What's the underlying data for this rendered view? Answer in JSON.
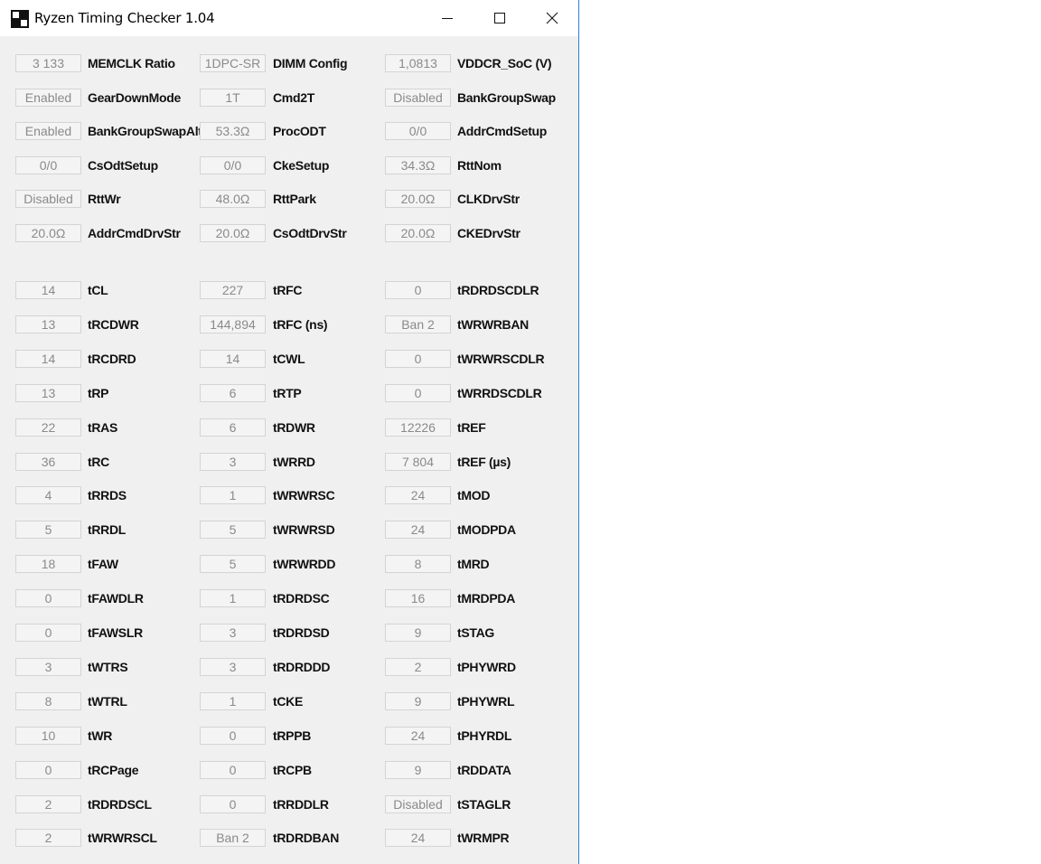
{
  "window": {
    "title": "Ryzen Timing Checker 1.04"
  },
  "settings": [
    [
      {
        "value": "3 133",
        "label": "MEMCLK Ratio"
      },
      {
        "value": "1DPC-SR",
        "label": "DIMM Config"
      },
      {
        "value": "1,0813",
        "label": "VDDCR_SoC (V)"
      }
    ],
    [
      {
        "value": "Enabled",
        "label": "GearDownMode"
      },
      {
        "value": "1T",
        "label": "Cmd2T"
      },
      {
        "value": "Disabled",
        "label": "BankGroupSwap"
      }
    ],
    [
      {
        "value": "Enabled",
        "label": "BankGroupSwapAlt"
      },
      {
        "value": "53.3Ω",
        "label": "ProcODT"
      },
      {
        "value": "0/0",
        "label": "AddrCmdSetup"
      }
    ],
    [
      {
        "value": "0/0",
        "label": "CsOdtSetup"
      },
      {
        "value": "0/0",
        "label": "CkeSetup"
      },
      {
        "value": "34.3Ω",
        "label": "RttNom"
      }
    ],
    [
      {
        "value": "Disabled",
        "label": "RttWr"
      },
      {
        "value": "48.0Ω",
        "label": "RttPark"
      },
      {
        "value": "20.0Ω",
        "label": "CLKDrvStr"
      }
    ],
    [
      {
        "value": "20.0Ω",
        "label": "AddrCmdDrvStr"
      },
      {
        "value": "20.0Ω",
        "label": "CsOdtDrvStr"
      },
      {
        "value": "20.0Ω",
        "label": "CKEDrvStr"
      }
    ]
  ],
  "timings": [
    [
      {
        "value": "14",
        "label": "tCL"
      },
      {
        "value": "227",
        "label": "tRFC"
      },
      {
        "value": "0",
        "label": "tRDRDSCDLR"
      }
    ],
    [
      {
        "value": "13",
        "label": "tRCDWR"
      },
      {
        "value": "144,894",
        "label": "tRFC (ns)"
      },
      {
        "value": "Ban 2",
        "label": "tWRWRBAN"
      }
    ],
    [
      {
        "value": "14",
        "label": "tRCDRD"
      },
      {
        "value": "14",
        "label": "tCWL"
      },
      {
        "value": "0",
        "label": "tWRWRSCDLR"
      }
    ],
    [
      {
        "value": "13",
        "label": "tRP"
      },
      {
        "value": "6",
        "label": "tRTP"
      },
      {
        "value": "0",
        "label": "tWRRDSCDLR"
      }
    ],
    [
      {
        "value": "22",
        "label": "tRAS"
      },
      {
        "value": "6",
        "label": "tRDWR"
      },
      {
        "value": "12226",
        "label": "tREF"
      }
    ],
    [
      {
        "value": "36",
        "label": "tRC"
      },
      {
        "value": "3",
        "label": "tWRRD"
      },
      {
        "value": "7 804",
        "label": "tREF (µs)"
      }
    ],
    [
      {
        "value": "4",
        "label": "tRRDS"
      },
      {
        "value": "1",
        "label": "tWRWRSC"
      },
      {
        "value": "24",
        "label": "tMOD"
      }
    ],
    [
      {
        "value": "5",
        "label": "tRRDL"
      },
      {
        "value": "5",
        "label": "tWRWRSD"
      },
      {
        "value": "24",
        "label": "tMODPDA"
      }
    ],
    [
      {
        "value": "18",
        "label": "tFAW"
      },
      {
        "value": "5",
        "label": "tWRWRDD"
      },
      {
        "value": "8",
        "label": "tMRD"
      }
    ],
    [
      {
        "value": "0",
        "label": "tFAWDLR"
      },
      {
        "value": "1",
        "label": "tRDRDSC"
      },
      {
        "value": "16",
        "label": "tMRDPDA"
      }
    ],
    [
      {
        "value": "0",
        "label": "tFAWSLR"
      },
      {
        "value": "3",
        "label": "tRDRDSD"
      },
      {
        "value": "9",
        "label": "tSTAG"
      }
    ],
    [
      {
        "value": "3",
        "label": "tWTRS"
      },
      {
        "value": "3",
        "label": "tRDRDDD"
      },
      {
        "value": "2",
        "label": "tPHYWRD"
      }
    ],
    [
      {
        "value": "8",
        "label": "tWTRL"
      },
      {
        "value": "1",
        "label": "tCKE"
      },
      {
        "value": "9",
        "label": "tPHYWRL"
      }
    ],
    [
      {
        "value": "10",
        "label": "tWR"
      },
      {
        "value": "0",
        "label": "tRPPB"
      },
      {
        "value": "24",
        "label": "tPHYRDL"
      }
    ],
    [
      {
        "value": "0",
        "label": "tRCPage"
      },
      {
        "value": "0",
        "label": "tRCPB"
      },
      {
        "value": "9",
        "label": "tRDDATA"
      }
    ],
    [
      {
        "value": "2",
        "label": "tRDRDSCL"
      },
      {
        "value": "0",
        "label": "tRRDDLR"
      },
      {
        "value": "Disabled",
        "label": "tSTAGLR"
      }
    ],
    [
      {
        "value": "2",
        "label": "tWRWRSCL"
      },
      {
        "value": "Ban 2",
        "label": "tRDRDBAN"
      },
      {
        "value": "24",
        "label": "tWRMPR"
      }
    ]
  ]
}
